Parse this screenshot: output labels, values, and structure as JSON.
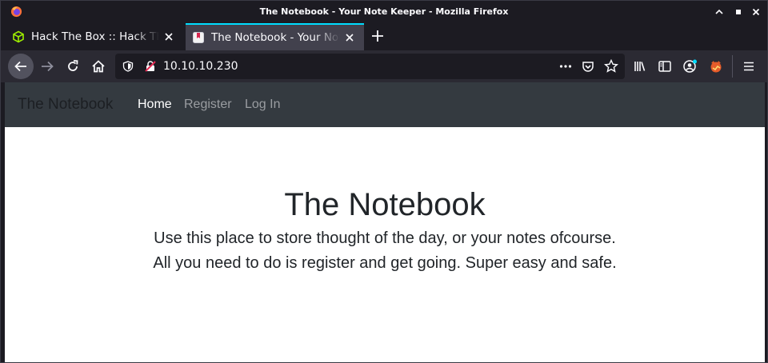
{
  "window": {
    "title": "The Notebook - Your Note Keeper - Mozilla Firefox"
  },
  "tabs": [
    {
      "label": "Hack The Box :: Hack The Box",
      "active": false,
      "icon": "hackthebox-cube-icon"
    },
    {
      "label": "The Notebook - Your Note Keeper",
      "active": true,
      "icon": "notebook-bookmark-icon"
    }
  ],
  "urlbar": {
    "url": "10.10.10.230"
  },
  "site": {
    "brand": "The Notebook",
    "nav": [
      {
        "label": "Home",
        "active": true
      },
      {
        "label": "Register",
        "active": false
      },
      {
        "label": "Log In",
        "active": false
      }
    ],
    "heading": "The Notebook",
    "line1": "Use this place to store thought of the day, or your notes ofcourse.",
    "line2": "All you need to do is register and get going. Super easy and safe."
  },
  "colors": {
    "accent_tab": "#00ddff",
    "site_navbar": "#343a40",
    "browser_chrome": "#1c1b22",
    "toolbar": "#2b2a33",
    "htb_green": "#9fef00"
  }
}
